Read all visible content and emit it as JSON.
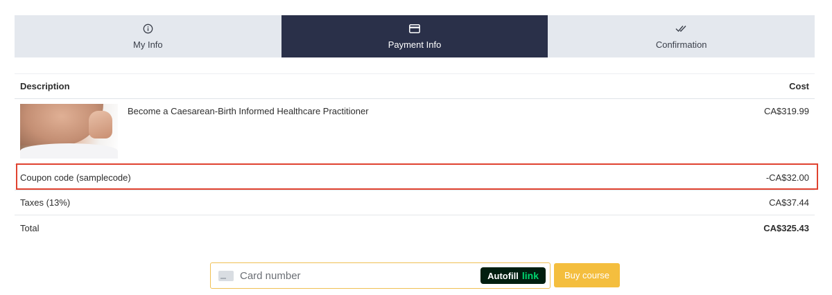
{
  "steps": [
    {
      "label": "My Info",
      "icon": "info-circle-icon",
      "active": false
    },
    {
      "label": "Payment Info",
      "icon": "credit-card-icon",
      "active": true
    },
    {
      "label": "Confirmation",
      "icon": "double-check-icon",
      "active": false
    }
  ],
  "table": {
    "header": {
      "description": "Description",
      "cost": "Cost"
    },
    "product": {
      "title": "Become a Caesarean-Birth Informed Healthcare Practitioner",
      "cost": "CA$319.99",
      "image": "product-thumbnail"
    },
    "coupon": {
      "label": "Coupon code (samplecode)",
      "amount": "-CA$32.00"
    },
    "taxes": {
      "label": "Taxes (13%)",
      "amount": "CA$37.44"
    },
    "total": {
      "label": "Total",
      "amount": "CA$325.43"
    }
  },
  "payment": {
    "card_placeholder": "Card number",
    "autofill_label": "Autofill",
    "autofill_link": "link",
    "buy_label": "Buy course"
  },
  "colors": {
    "active_step_bg": "#2a3049",
    "inactive_step_bg": "#e4e8ee",
    "highlight_border": "#e0422f",
    "buy_button": "#f4be3e",
    "autofill_bg": "#011e0f",
    "autofill_link": "#00d66f"
  }
}
